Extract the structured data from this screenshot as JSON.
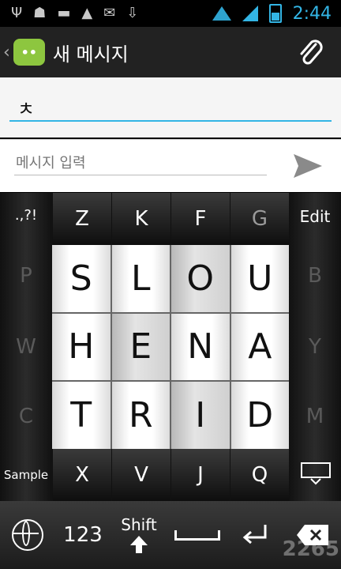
{
  "status_bar": {
    "time": "2:44",
    "icons": [
      "usb-icon",
      "android-icon",
      "sd-card-icon",
      "warning-icon",
      "gmail-icon",
      "download-icon"
    ]
  },
  "action_bar": {
    "title": "새 메시지",
    "back_glyph": "‹"
  },
  "recipient": {
    "value": "ㅊ"
  },
  "compose": {
    "placeholder": "메시지 입력"
  },
  "keyboard": {
    "corner_top_left": ".,?!",
    "corner_top_right": "Edit",
    "corner_bottom_left": "Sample",
    "top_row": [
      "Z",
      "K",
      "F",
      "G"
    ],
    "left_side": [
      "P",
      "W",
      "C"
    ],
    "right_side": [
      "B",
      "Y",
      "M"
    ],
    "grid": [
      [
        "S",
        "L",
        "O",
        "U"
      ],
      [
        "H",
        "E",
        "N",
        "A"
      ],
      [
        "T",
        "R",
        "I",
        "D"
      ]
    ],
    "bottom_row": [
      "X",
      "V",
      "J",
      "Q"
    ],
    "bottom_bar": {
      "numbers_label": "123",
      "shift_label": "Shift"
    }
  },
  "watermark": "2265"
}
